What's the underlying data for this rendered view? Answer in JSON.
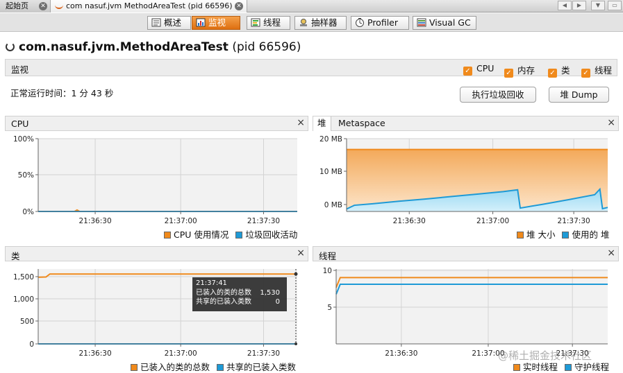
{
  "doc_tabs": [
    {
      "label": "起始页"
    },
    {
      "label": "com nasuf.jvm MethodAreaTest (pid 66596)"
    }
  ],
  "view_tabs": [
    {
      "label": "概述",
      "icon": "overview-icon"
    },
    {
      "label": "监视",
      "icon": "monitor-icon",
      "active": true
    },
    {
      "label": "线程",
      "icon": "threads-icon"
    },
    {
      "label": "抽样器",
      "icon": "sampler-icon"
    },
    {
      "label": "Profiler",
      "icon": "profiler-icon"
    },
    {
      "label": "Visual GC",
      "icon": "visualgc-icon"
    }
  ],
  "app_title": {
    "name": "com.nasuf.jvm.MethodAreaTest",
    "pid": "(pid 66596)"
  },
  "monitor": {
    "label": "监视",
    "checkboxes": [
      {
        "label": "CPU",
        "checked": true
      },
      {
        "label": "内存",
        "checked": true
      },
      {
        "label": "类",
        "checked": true
      },
      {
        "label": "线程",
        "checked": true
      }
    ],
    "uptime": "正常运行时间：1 分 43 秒",
    "gc_button": "执行垃圾回收",
    "dump_button": "堆 Dump"
  },
  "colors": {
    "accent": "#f08a1c",
    "blue": "#1e9ad6",
    "orange_line": "#f08a1c"
  },
  "panels": {
    "cpu": {
      "title": "CPU",
      "close": "×",
      "y_ticks": [
        "100%",
        "50%",
        "0%"
      ],
      "x_ticks": [
        "21:36:30",
        "21:37:00",
        "21:37:30"
      ],
      "legend": [
        "CPU 使用情况",
        "垃圾回收活动"
      ]
    },
    "heap": {
      "tab_heap": "堆",
      "tab_meta": "Metaspace",
      "close": "×",
      "y_ticks": [
        "20 MB",
        "10 MB",
        "0 MB"
      ],
      "x_ticks": [
        "21:36:30",
        "21:37:00",
        "21:37:30"
      ],
      "legend": [
        "堆 大小",
        "使用的 堆"
      ]
    },
    "classes": {
      "title": "类",
      "close": "×",
      "y_ticks": [
        "1,500",
        "1,000",
        "500",
        "0"
      ],
      "x_ticks": [
        "21:36:30",
        "21:37:00",
        "21:37:30"
      ],
      "legend": [
        "已装入的类的总数",
        "共享的已装入类数"
      ]
    },
    "threads": {
      "title": "线程",
      "close": "×",
      "y_ticks": [
        "10",
        "5"
      ],
      "x_ticks": [
        "21:36:30",
        "21:37:00",
        "21:37:30"
      ],
      "legend": [
        "实时线程",
        "守护线程"
      ]
    }
  },
  "tooltip": {
    "time": "21:37:41",
    "row1_label": "已装入的类的总数",
    "row1_value": "1,530",
    "row2_label": "共享的已装入类数",
    "row2_value": "0"
  },
  "watermark": "@稀土掘金技术社区",
  "chart_data": [
    {
      "type": "line",
      "title": "CPU",
      "ylim": [
        0,
        100
      ],
      "yticks": [
        "100%",
        "50%",
        "0%"
      ],
      "xticks": [
        "21:36:30",
        "21:37:00",
        "21:37:30"
      ],
      "series": [
        {
          "name": "CPU 使用情况",
          "x": [
            0,
            0.14,
            0.15,
            0.16,
            1
          ],
          "y": [
            0,
            0,
            2,
            0,
            0
          ]
        },
        {
          "name": "垃圾回收活动",
          "x": [
            0,
            1
          ],
          "y": [
            0,
            0
          ]
        }
      ]
    },
    {
      "type": "area",
      "title": "堆",
      "ylim": [
        0,
        23.5
      ],
      "yticks": [
        "20 MB",
        "10 MB",
        "0 MB"
      ],
      "xticks": [
        "21:36:30",
        "21:37:00",
        "21:37:30"
      ],
      "series": [
        {
          "name": "堆 大小",
          "x": [
            0,
            1
          ],
          "y": [
            20,
            20
          ]
        },
        {
          "name": "使用的 堆",
          "x": [
            0,
            0.03,
            0.1,
            0.2,
            0.3,
            0.4,
            0.5,
            0.6,
            0.655,
            0.665,
            0.75,
            0.85,
            0.95,
            0.97,
            0.98,
            1
          ],
          "y": [
            0.8,
            2,
            2.5,
            3.3,
            4.0,
            4.8,
            5.6,
            6.4,
            7.0,
            1.1,
            2.3,
            3.8,
            5.4,
            7.2,
            0.9,
            1.3
          ]
        }
      ]
    },
    {
      "type": "line",
      "title": "类",
      "ylim": [
        0,
        1640
      ],
      "yticks": [
        "1,500",
        "1,000",
        "500",
        "0"
      ],
      "xticks": [
        "21:36:30",
        "21:37:00",
        "21:37:30"
      ],
      "series": [
        {
          "name": "已装入的类的总数",
          "x": [
            0,
            0.03,
            0.045,
            1
          ],
          "y": [
            1460,
            1465,
            1530,
            1530
          ]
        },
        {
          "name": "共享的已装入类数",
          "x": [
            0,
            1
          ],
          "y": [
            0,
            0
          ]
        }
      ]
    },
    {
      "type": "line",
      "title": "线程",
      "ylim": [
        0,
        11.3
      ],
      "yticks": [
        "10",
        "5"
      ],
      "xticks": [
        "21:36:30",
        "21:37:00",
        "21:37:30"
      ],
      "series": [
        {
          "name": "实时线程",
          "x": [
            0,
            0.015,
            1
          ],
          "y": [
            8.5,
            10,
            10
          ]
        },
        {
          "name": "守护线程",
          "x": [
            0,
            0.015,
            1
          ],
          "y": [
            7.5,
            9,
            9
          ]
        }
      ]
    }
  ]
}
